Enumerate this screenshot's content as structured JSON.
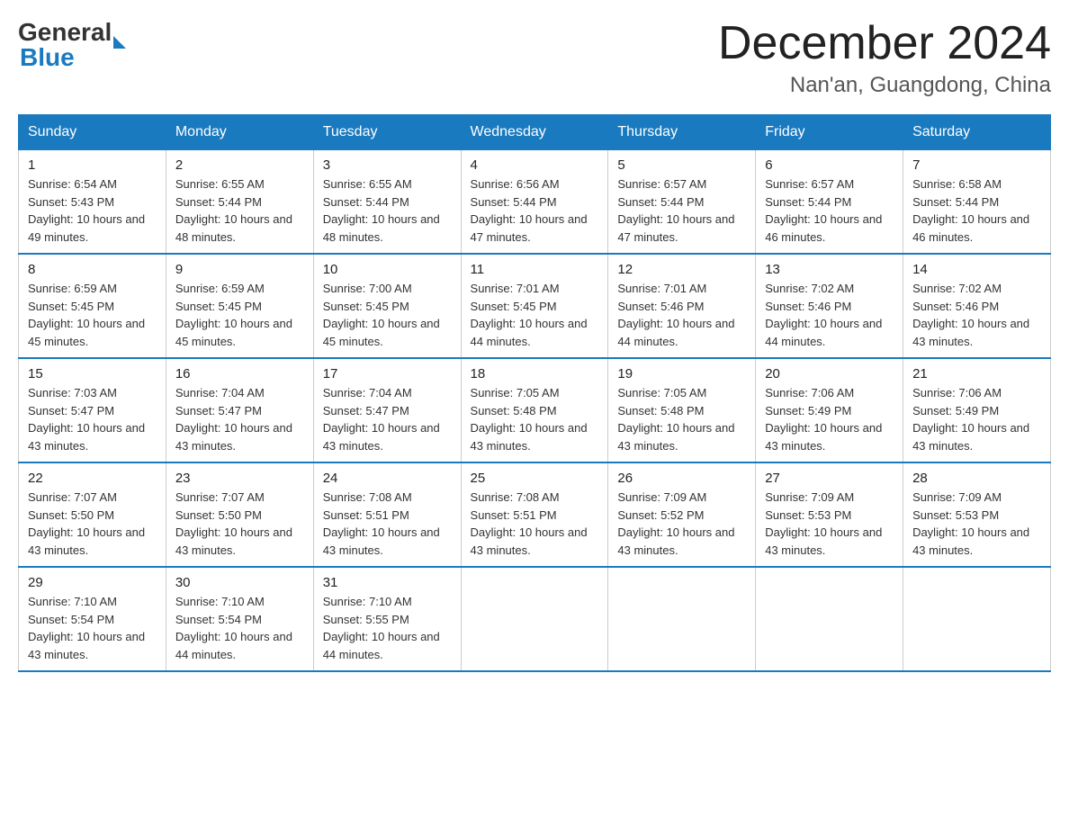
{
  "logo": {
    "text_general": "General",
    "text_blue": "Blue"
  },
  "header": {
    "month_title": "December 2024",
    "location": "Nan'an, Guangdong, China"
  },
  "days_of_week": [
    "Sunday",
    "Monday",
    "Tuesday",
    "Wednesday",
    "Thursday",
    "Friday",
    "Saturday"
  ],
  "weeks": [
    [
      {
        "day": "1",
        "sunrise": "6:54 AM",
        "sunset": "5:43 PM",
        "daylight": "10 hours and 49 minutes."
      },
      {
        "day": "2",
        "sunrise": "6:55 AM",
        "sunset": "5:44 PM",
        "daylight": "10 hours and 48 minutes."
      },
      {
        "day": "3",
        "sunrise": "6:55 AM",
        "sunset": "5:44 PM",
        "daylight": "10 hours and 48 minutes."
      },
      {
        "day": "4",
        "sunrise": "6:56 AM",
        "sunset": "5:44 PM",
        "daylight": "10 hours and 47 minutes."
      },
      {
        "day": "5",
        "sunrise": "6:57 AM",
        "sunset": "5:44 PM",
        "daylight": "10 hours and 47 minutes."
      },
      {
        "day": "6",
        "sunrise": "6:57 AM",
        "sunset": "5:44 PM",
        "daylight": "10 hours and 46 minutes."
      },
      {
        "day": "7",
        "sunrise": "6:58 AM",
        "sunset": "5:44 PM",
        "daylight": "10 hours and 46 minutes."
      }
    ],
    [
      {
        "day": "8",
        "sunrise": "6:59 AM",
        "sunset": "5:45 PM",
        "daylight": "10 hours and 45 minutes."
      },
      {
        "day": "9",
        "sunrise": "6:59 AM",
        "sunset": "5:45 PM",
        "daylight": "10 hours and 45 minutes."
      },
      {
        "day": "10",
        "sunrise": "7:00 AM",
        "sunset": "5:45 PM",
        "daylight": "10 hours and 45 minutes."
      },
      {
        "day": "11",
        "sunrise": "7:01 AM",
        "sunset": "5:45 PM",
        "daylight": "10 hours and 44 minutes."
      },
      {
        "day": "12",
        "sunrise": "7:01 AM",
        "sunset": "5:46 PM",
        "daylight": "10 hours and 44 minutes."
      },
      {
        "day": "13",
        "sunrise": "7:02 AM",
        "sunset": "5:46 PM",
        "daylight": "10 hours and 44 minutes."
      },
      {
        "day": "14",
        "sunrise": "7:02 AM",
        "sunset": "5:46 PM",
        "daylight": "10 hours and 43 minutes."
      }
    ],
    [
      {
        "day": "15",
        "sunrise": "7:03 AM",
        "sunset": "5:47 PM",
        "daylight": "10 hours and 43 minutes."
      },
      {
        "day": "16",
        "sunrise": "7:04 AM",
        "sunset": "5:47 PM",
        "daylight": "10 hours and 43 minutes."
      },
      {
        "day": "17",
        "sunrise": "7:04 AM",
        "sunset": "5:47 PM",
        "daylight": "10 hours and 43 minutes."
      },
      {
        "day": "18",
        "sunrise": "7:05 AM",
        "sunset": "5:48 PM",
        "daylight": "10 hours and 43 minutes."
      },
      {
        "day": "19",
        "sunrise": "7:05 AM",
        "sunset": "5:48 PM",
        "daylight": "10 hours and 43 minutes."
      },
      {
        "day": "20",
        "sunrise": "7:06 AM",
        "sunset": "5:49 PM",
        "daylight": "10 hours and 43 minutes."
      },
      {
        "day": "21",
        "sunrise": "7:06 AM",
        "sunset": "5:49 PM",
        "daylight": "10 hours and 43 minutes."
      }
    ],
    [
      {
        "day": "22",
        "sunrise": "7:07 AM",
        "sunset": "5:50 PM",
        "daylight": "10 hours and 43 minutes."
      },
      {
        "day": "23",
        "sunrise": "7:07 AM",
        "sunset": "5:50 PM",
        "daylight": "10 hours and 43 minutes."
      },
      {
        "day": "24",
        "sunrise": "7:08 AM",
        "sunset": "5:51 PM",
        "daylight": "10 hours and 43 minutes."
      },
      {
        "day": "25",
        "sunrise": "7:08 AM",
        "sunset": "5:51 PM",
        "daylight": "10 hours and 43 minutes."
      },
      {
        "day": "26",
        "sunrise": "7:09 AM",
        "sunset": "5:52 PM",
        "daylight": "10 hours and 43 minutes."
      },
      {
        "day": "27",
        "sunrise": "7:09 AM",
        "sunset": "5:53 PM",
        "daylight": "10 hours and 43 minutes."
      },
      {
        "day": "28",
        "sunrise": "7:09 AM",
        "sunset": "5:53 PM",
        "daylight": "10 hours and 43 minutes."
      }
    ],
    [
      {
        "day": "29",
        "sunrise": "7:10 AM",
        "sunset": "5:54 PM",
        "daylight": "10 hours and 43 minutes."
      },
      {
        "day": "30",
        "sunrise": "7:10 AM",
        "sunset": "5:54 PM",
        "daylight": "10 hours and 44 minutes."
      },
      {
        "day": "31",
        "sunrise": "7:10 AM",
        "sunset": "5:55 PM",
        "daylight": "10 hours and 44 minutes."
      },
      null,
      null,
      null,
      null
    ]
  ]
}
